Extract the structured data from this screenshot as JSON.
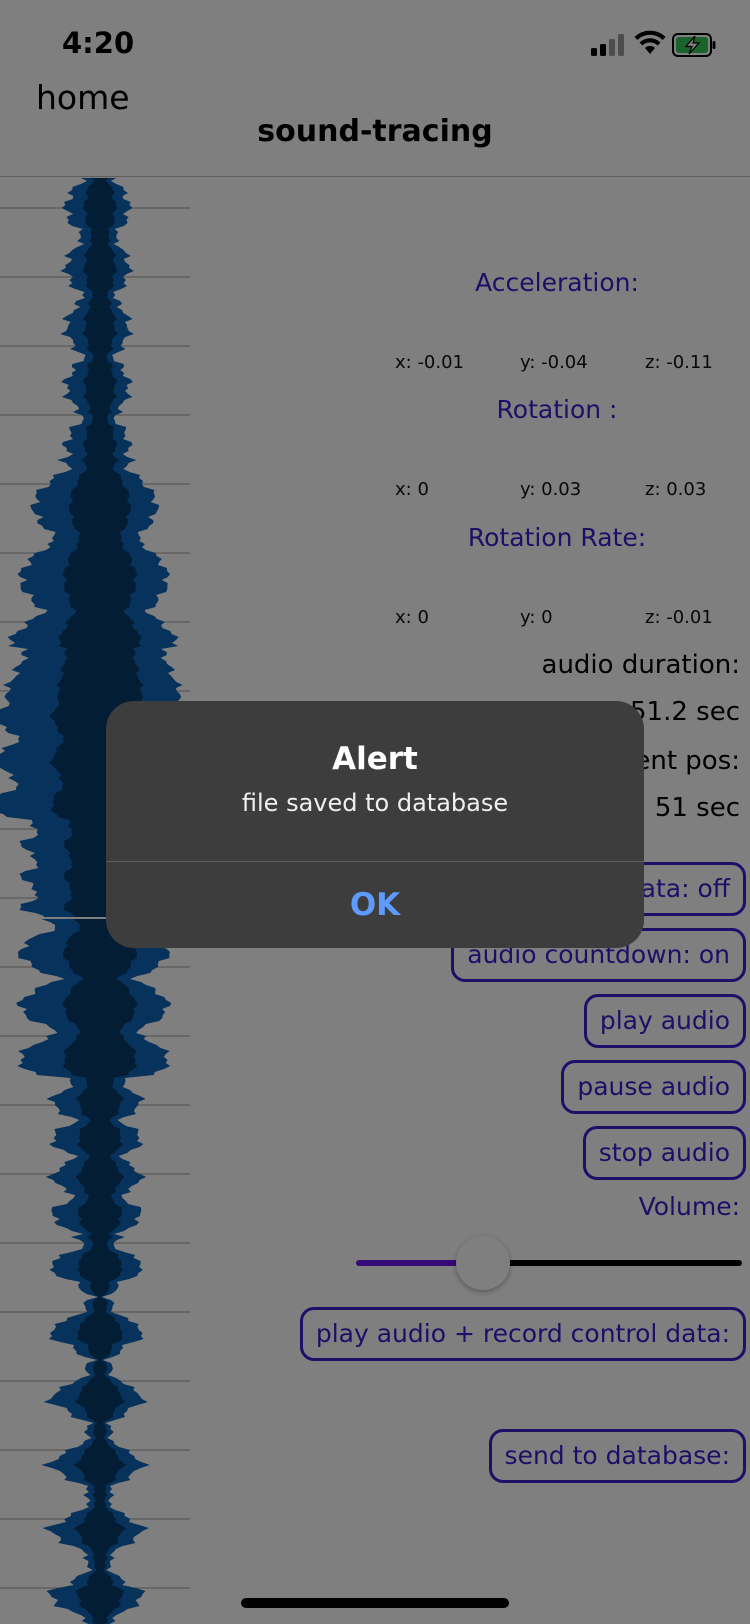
{
  "status_bar": {
    "time": "4:20"
  },
  "nav": {
    "back_label": "home",
    "title": "sound-tracing"
  },
  "sensors": {
    "acceleration": {
      "label": "Acceleration:",
      "x": "x: -0.01",
      "y": "y: -0.04",
      "z": "z: -0.11"
    },
    "rotation": {
      "label": "Rotation :",
      "x": "x: 0",
      "y": "y: 0.03",
      "z": "z: 0.03"
    },
    "rotation_rate": {
      "label": "Rotation Rate:",
      "x": "x: 0",
      "y": "y: 0",
      "z": "z: -0.01"
    }
  },
  "audio": {
    "duration_label": "audio duration:",
    "duration_value": "51.2 sec",
    "position_label": "current pos:",
    "position_value": "51 sec"
  },
  "buttons": {
    "control_data": "control data: off",
    "audio_countdown": "audio countdown: on",
    "play_audio": "play audio",
    "pause_audio": "pause audio",
    "stop_audio": "stop audio",
    "play_record": "play audio + record control data:",
    "send_db": "send to database:"
  },
  "volume": {
    "label": "Volume:",
    "level": 0.33
  },
  "alert": {
    "title": "Alert",
    "message": "file saved to database",
    "ok_label": "OK"
  },
  "colors": {
    "accent": "#3a1ccf",
    "slider_fill": "#6a14f0",
    "alert_bg": "#3d3d3d",
    "alert_ok": "#5f9bff",
    "waveform": "#0d64b8",
    "waveform_core": "#063a6a"
  }
}
